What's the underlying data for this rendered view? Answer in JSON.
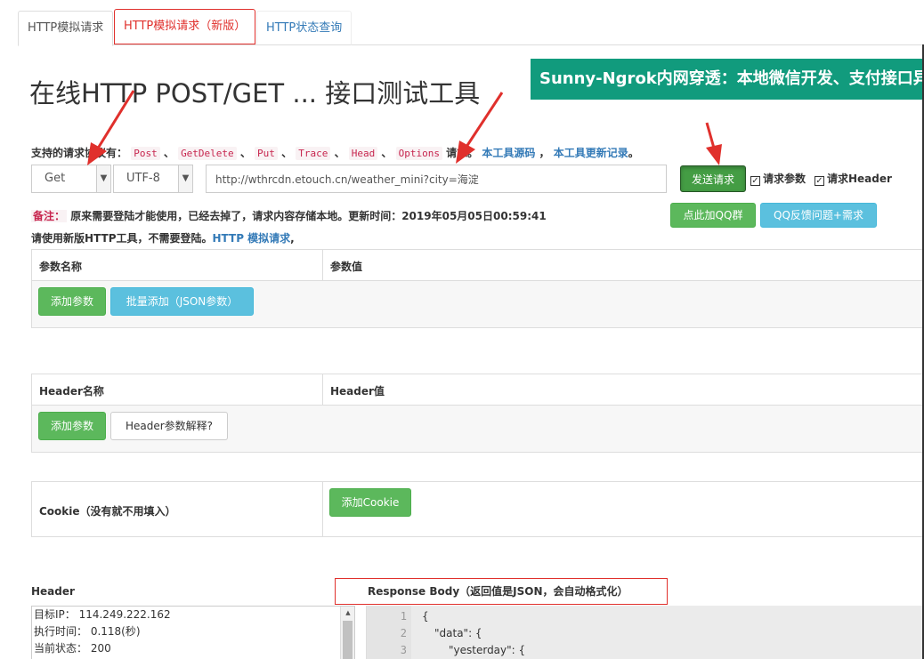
{
  "tabs": [
    {
      "label": "HTTP模拟请求"
    },
    {
      "label": "HTTP模拟请求（新版）"
    },
    {
      "label": "HTTP状态查询"
    }
  ],
  "page_title": "在线HTTP POST/GET ... 接口测试工具",
  "banner": "Sunny-Ngrok内网穿透：本地微信开发、支付接口异",
  "methods": {
    "prefix": "支持的请求协议有：",
    "list": [
      "Post",
      "GetDelete",
      "Put",
      "Trace",
      "Head",
      "Options"
    ],
    "suffix": "请求。",
    "source_link": "本工具源码",
    "changelog_link": "本工具更新记录"
  },
  "method_select": "Get",
  "encoding_select": "UTF-8",
  "url_value": "http://wthrcdn.etouch.cn/weather_mini?city=海淀",
  "send_button": "发送请求",
  "checkbox_params": "请求参数",
  "checkbox_header": "请求Header",
  "note": {
    "label": "备注：",
    "text": "原来需要登陆才能使用，已经去掉了，请求内容存储本地。更新时间：2019年05月05日00:59:41"
  },
  "note2": {
    "text": "请使用新版HTTP工具，不需要登陆。",
    "link": "HTTP 模拟请求",
    "suffix": ","
  },
  "qq_group_button": "点此加QQ群",
  "qq_feedback_button": "QQ反馈问题+需求",
  "params_table": {
    "col_name": "参数名称",
    "col_value": "参数值",
    "add_button": "添加参数",
    "bulk_button": "批量添加（JSON参数）"
  },
  "header_table": {
    "col_name": "Header名称",
    "col_value": "Header值",
    "add_button": "添加参数",
    "explain_button": "Header参数解释?"
  },
  "cookie": {
    "label": "Cookie（没有就不用填入）",
    "add_button": "添加Cookie"
  },
  "response": {
    "header_label": "Header",
    "body_label": "Response Body（返回值是JSON，会自动格式化）",
    "header_lines": [
      "目标IP： 114.249.222.162",
      "执行时间： 0.118(秒)",
      "当前状态： 200"
    ],
    "body_lines": [
      {
        "n": "1",
        "text": "{"
      },
      {
        "n": "2",
        "text": "\"data\": {"
      },
      {
        "n": "3",
        "text": "\"yesterday\": {"
      }
    ]
  },
  "colors": {
    "link": "#337ab7",
    "green": "#5cb85c",
    "blue": "#5bc0de",
    "annotation_red": "#e0302c",
    "banner": "#119b7d"
  }
}
